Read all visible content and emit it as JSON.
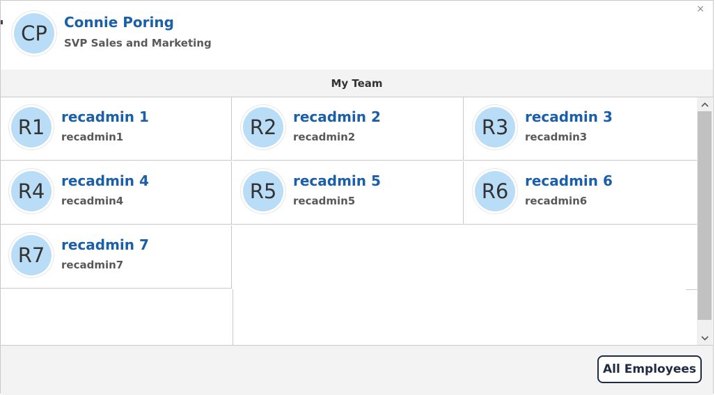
{
  "close_label": "×",
  "profile": {
    "initials": "CP",
    "name": "Connie Poring",
    "title": "SVP Sales and Marketing"
  },
  "team_header": "My Team",
  "team": [
    {
      "initials": "R1",
      "name": "recadmin 1",
      "username": "recadmin1"
    },
    {
      "initials": "R2",
      "name": "recadmin 2",
      "username": "recadmin2"
    },
    {
      "initials": "R3",
      "name": "recadmin 3",
      "username": "recadmin3"
    },
    {
      "initials": "R4",
      "name": "recadmin 4",
      "username": "recadmin4"
    },
    {
      "initials": "R5",
      "name": "recadmin 5",
      "username": "recadmin5"
    },
    {
      "initials": "R6",
      "name": "recadmin 6",
      "username": "recadmin6"
    },
    {
      "initials": "R7",
      "name": "recadmin 7",
      "username": "recadmin7"
    }
  ],
  "scrollbar": {
    "up_icon": "chevron-up-icon",
    "down_icon": "chevron-down-icon"
  },
  "footer": {
    "all_employees_label": "All Employees"
  },
  "colors": {
    "avatar_bg": "#b9ddf6",
    "link": "#1a5fa8",
    "button_border": "#1f2b45"
  }
}
